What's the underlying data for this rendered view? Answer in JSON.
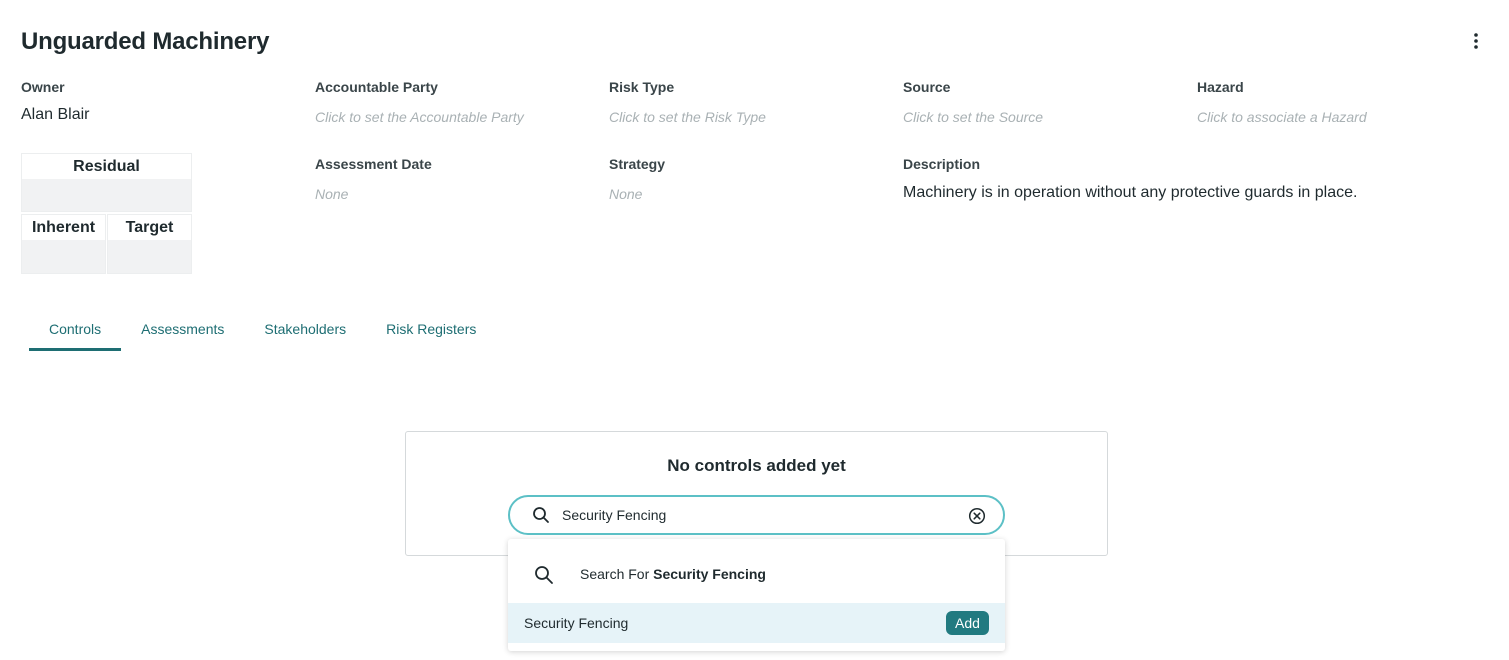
{
  "header": {
    "title": "Unguarded Machinery",
    "more_icon": "vertical-ellipsis-icon"
  },
  "fields": {
    "owner": {
      "label": "Owner",
      "value": "Alan Blair"
    },
    "accountable_party": {
      "label": "Accountable Party",
      "placeholder": "Click to set the Accountable Party"
    },
    "risk_type": {
      "label": "Risk Type",
      "placeholder": "Click to set the Risk Type"
    },
    "source": {
      "label": "Source",
      "placeholder": "Click to set the Source"
    },
    "hazard": {
      "label": "Hazard",
      "placeholder": "Click to associate a Hazard"
    },
    "assessment_date": {
      "label": "Assessment Date",
      "value": "None"
    },
    "strategy": {
      "label": "Strategy",
      "value": "None"
    },
    "description": {
      "label": "Description",
      "value": "Machinery is in operation without any protective guards in place."
    }
  },
  "scores": {
    "residual": "Residual",
    "inherent": "Inherent",
    "target": "Target"
  },
  "tabs": [
    {
      "label": "Controls",
      "active": true
    },
    {
      "label": "Assessments",
      "active": false
    },
    {
      "label": "Stakeholders",
      "active": false
    },
    {
      "label": "Risk Registers",
      "active": false
    }
  ],
  "controls": {
    "empty_title": "No controls added yet",
    "search_value": "Security Fencing",
    "search_icon": "search-icon",
    "clear_icon": "clear-circle-icon",
    "dropdown": {
      "search_prefix": "Search For",
      "search_term": "Security Fencing",
      "item_label": "Security Fencing",
      "add_label": "Add"
    }
  },
  "colors": {
    "accent": "#1e6e73",
    "search_border": "#5cc0c6",
    "highlight": "#e6f3f8",
    "button": "#217a80"
  }
}
